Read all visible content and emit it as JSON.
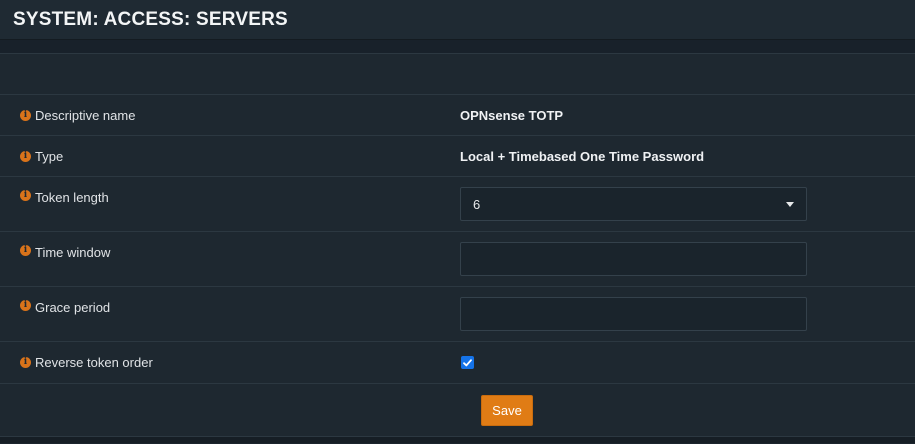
{
  "header": {
    "title": "SYSTEM: ACCESS: SERVERS"
  },
  "form": {
    "descriptive_name": {
      "label": "Descriptive name",
      "value": "OPNsense TOTP"
    },
    "type": {
      "label": "Type",
      "value": "Local + Timebased One Time Password"
    },
    "token_length": {
      "label": "Token length",
      "selected": "6"
    },
    "time_window": {
      "label": "Time window",
      "value": ""
    },
    "grace_period": {
      "label": "Grace period",
      "value": ""
    },
    "reverse_token_order": {
      "label": "Reverse token order",
      "checked": true
    },
    "save_label": "Save"
  },
  "icons": {
    "info": "info-icon",
    "dropdown": "chevron-down-icon",
    "check": "checkmark-icon"
  },
  "colors": {
    "accent": "#e07c15",
    "info_icon": "#d9731a",
    "checkbox": "#1573e8",
    "background": "#1b252d"
  }
}
